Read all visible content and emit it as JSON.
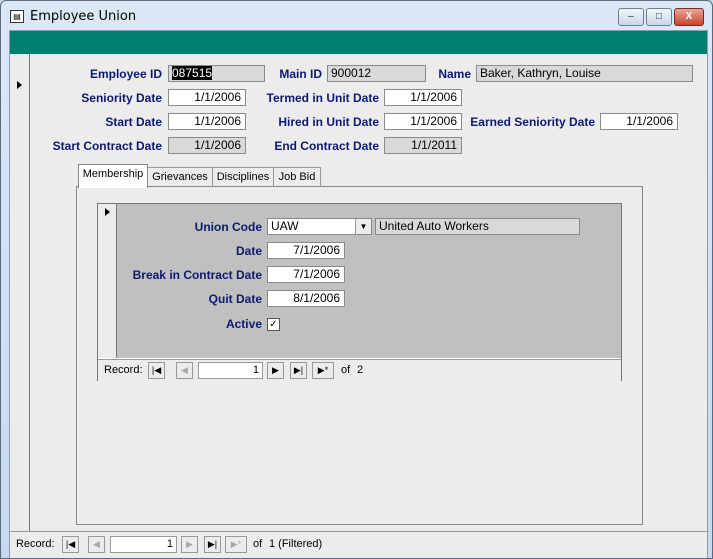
{
  "window": {
    "title": "Employee Union",
    "minimize": "–",
    "maximize": "□",
    "close": "X",
    "icon": "form-icon"
  },
  "employee": {
    "id_label": "Employee ID",
    "id_value": "087515",
    "main_id_label": "Main ID",
    "main_id_value": "900012",
    "name_label": "Name",
    "name_value": "Baker, Kathryn, Louise",
    "seniority_label": "Seniority Date",
    "seniority_value": "1/1/2006",
    "termed_label": "Termed in Unit Date",
    "termed_value": "1/1/2006",
    "start_label": "Start Date",
    "start_value": "1/1/2006",
    "hired_label": "Hired in Unit Date",
    "hired_value": "1/1/2006",
    "earned_label": "Earned Seniority Date",
    "earned_value": "1/1/2006",
    "start_contract_label": "Start Contract Date",
    "start_contract_value": "1/1/2006",
    "end_contract_label": "End Contract Date",
    "end_contract_value": "1/1/2011"
  },
  "tabs": [
    {
      "label": "Membership",
      "active": true
    },
    {
      "label": "Grievances"
    },
    {
      "label": "Disciplines"
    },
    {
      "label": "Job Bid"
    }
  ],
  "membership": {
    "union_code_label": "Union Code",
    "union_code_value": "UAW",
    "union_name": "United Auto Workers",
    "date_label": "Date",
    "date_value": "7/1/2006",
    "break_label": "Break in Contract Date",
    "break_value": "7/1/2006",
    "quit_label": "Quit Date",
    "quit_value": "8/1/2006",
    "active_label": "Active",
    "active_checked": true,
    "check_glyph": "✓"
  },
  "subnav": {
    "record_label": "Record:",
    "current": "1",
    "of_text": "of",
    "total": "2"
  },
  "mainnav": {
    "record_label": "Record:",
    "current": "1",
    "of_text": "of",
    "total": "1 (Filtered)"
  },
  "nav_glyphs": {
    "first": "|◀",
    "prev": "◀",
    "next": "▶",
    "last": "▶|",
    "new": "▶*",
    "dropdown": "▼"
  },
  "colors": {
    "header_band": "#007e6f",
    "label_text": "#0b1a6e",
    "readonly_field": "#d9d9d9"
  }
}
